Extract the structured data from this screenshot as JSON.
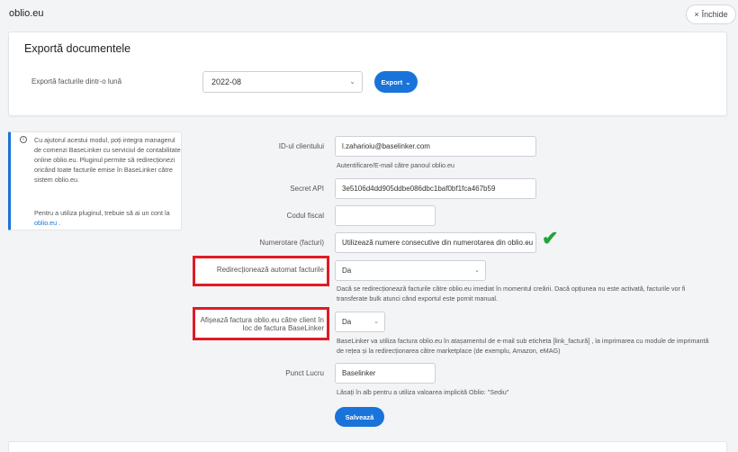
{
  "app": {
    "title": "oblio.eu",
    "close_label": "Închide"
  },
  "export": {
    "title": "Exportă documentele",
    "month_label": "Exportă facturile dintr-o lună",
    "month_value": "2022-08",
    "export_label": "Export"
  },
  "info": {
    "text1": "Cu ajutorul acestui modul, poți integra managerul de comenzi BaseLinker cu serviciul de contabilitate online oblio.eu. Pluginul permite să redirecționezi oricând toate facturile emise în BaseLinker către sistem oblio.eu.",
    "text2_pre": "Pentru a utiliza pluginul, trebuie să ai un cont la ",
    "link": "oblio.eu",
    "text2_post": " ."
  },
  "form": {
    "client_id": {
      "label": "ID-ul clientului",
      "value": "l.zaharioiu@baselinker.com",
      "help": "Autentificare/E-mail către panoul oblio.eu"
    },
    "secret": {
      "label": "Secret API",
      "value": "3e5106d4dd905ddbe086dbc1baf0bf1fca467b59"
    },
    "fiscal": {
      "label": "Codul fiscal",
      "value": ""
    },
    "numbering": {
      "label": "Numerotare (facturi)",
      "value": "Utilizează numere consecutive din numerotarea din oblio.eu"
    },
    "redirect": {
      "label": "Redirecționează automat facturile",
      "value": "Da",
      "help": "Dacă se redirecționează facturile către oblio.eu imediat în momentul creării. Dacă opțiunea nu este activată, facturile vor fi transferate bulk atunci când exportul este pornit manual."
    },
    "show_invoice": {
      "label": "Afișează factura oblio.eu către client în loc de factura BaseLinker",
      "value": "Da",
      "help": "BaseLinker va utiliza factura oblio.eu în atașamentul de e-mail sub eticheta [link_factură] , la imprimarea cu module de imprimantă de rețea și la redirecționarea către marketplace (de exemplu, Amazon, eMAG)"
    },
    "workplace": {
      "label": "Punct Lucru",
      "value": "Baselinker",
      "help": "Lăsați în alb pentru a utiliza valoarea implicită Oblio: \"Sediu\""
    },
    "save_label": "Salvează"
  },
  "icons": [
    "close-icon",
    "chevron-down-icon",
    "info-icon",
    "check-icon"
  ],
  "colors": {
    "accent": "#1a73d9",
    "highlight": "#e01b24",
    "success": "#1fa53a"
  }
}
